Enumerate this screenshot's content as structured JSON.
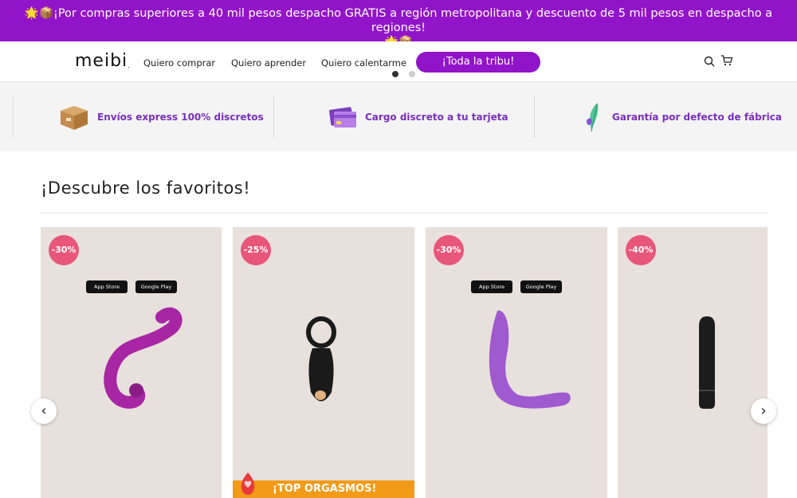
{
  "promo": {
    "text": "🌟📦¡Por compras superiores a 40 mil pesos despacho GRATIS a región metropolitana y descuento de 5 mil pesos en despacho a regiones!",
    "text2": "🌟📦"
  },
  "header": {
    "logo": "meibi",
    "logo_dot": ".",
    "nav": [
      "Quiero comprar",
      "Quiero aprender",
      "Quiero calentarme"
    ],
    "cta": "¡Toda la tribu!",
    "icons": [
      "search-icon",
      "cart-icon"
    ]
  },
  "features": [
    {
      "label": "Envíos express 100% discretos",
      "icon": "box-icon"
    },
    {
      "label": "Cargo discreto a tu tarjeta",
      "icon": "credit-card-icon"
    },
    {
      "label": "Garantía por defecto de fábrica",
      "icon": "feather-icon"
    }
  ],
  "section": {
    "title": "¡Descubre los favoritos!"
  },
  "products": [
    {
      "discount": "-30%",
      "app_store": "App Store",
      "google_play": "Google Play",
      "color": "#b02ca8"
    },
    {
      "discount": "-25%",
      "banner": "¡TOP ORGASMOS!",
      "color": "#1a1a1a"
    },
    {
      "discount": "-30%",
      "app_store": "App Store",
      "google_play": "Google Play",
      "color": "#a05ad0"
    },
    {
      "discount": "-40%",
      "color": "#1c1c1c"
    }
  ],
  "carousel": {
    "prev": "‹",
    "next": "›"
  },
  "colors": {
    "brand": "#9214c8",
    "badge": "#e8567a",
    "banner": "#f39a16"
  }
}
